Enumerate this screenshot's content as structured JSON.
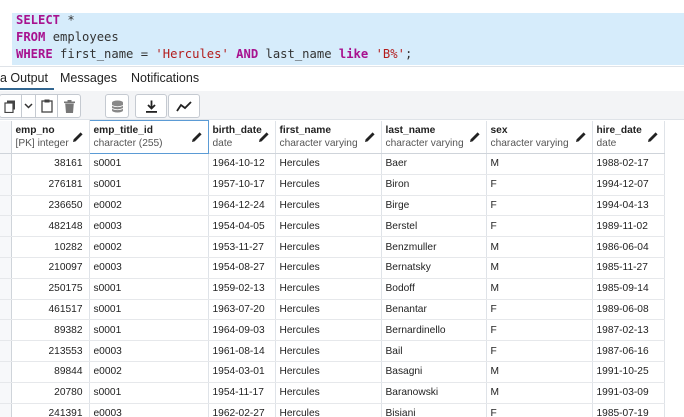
{
  "editor": {
    "line1": {
      "kw": "SELECT",
      "rest": " *"
    },
    "line2": {
      "kw": "FROM",
      "rest": " employees"
    },
    "line3": {
      "kw1": "WHERE",
      "p1": " first_name = ",
      "s1": "'Hercules'",
      "p2": " ",
      "kw2": "AND",
      "p3": " last_name ",
      "kw3": "like",
      "p4": " ",
      "s2": "'B%'",
      "p5": ";"
    }
  },
  "tabs": [
    {
      "label": "a Output",
      "active": true
    },
    {
      "label": "Messages",
      "active": false
    },
    {
      "label": "Notifications",
      "active": false
    }
  ],
  "toolbar": {
    "icons": [
      "copy-icon",
      "dropdown-arrow-icon",
      "paste-icon",
      "delete-icon",
      "save-data-icon",
      "download-icon",
      "graph-icon"
    ]
  },
  "columns": [
    {
      "name": "emp_no",
      "type": "[PK] integer"
    },
    {
      "name": "emp_title_id",
      "type": "character (255)"
    },
    {
      "name": "birth_date",
      "type": "date"
    },
    {
      "name": "first_name",
      "type": "character varying"
    },
    {
      "name": "last_name",
      "type": "character varying"
    },
    {
      "name": "sex",
      "type": "character varying"
    },
    {
      "name": "hire_date",
      "type": "date"
    }
  ],
  "rows": [
    [
      "38161",
      "s0001",
      "1964-10-12",
      "Hercules",
      "Baer",
      "M",
      "1988-02-17"
    ],
    [
      "276181",
      "s0001",
      "1957-10-17",
      "Hercules",
      "Biron",
      "F",
      "1994-12-07"
    ],
    [
      "236650",
      "e0002",
      "1964-12-24",
      "Hercules",
      "Birge",
      "F",
      "1994-04-13"
    ],
    [
      "482148",
      "e0003",
      "1954-04-05",
      "Hercules",
      "Berstel",
      "F",
      "1989-11-02"
    ],
    [
      "10282",
      "e0002",
      "1953-11-27",
      "Hercules",
      "Benzmuller",
      "M",
      "1986-06-04"
    ],
    [
      "210097",
      "e0003",
      "1954-08-27",
      "Hercules",
      "Bernatsky",
      "M",
      "1985-11-27"
    ],
    [
      "250175",
      "s0001",
      "1959-02-13",
      "Hercules",
      "Bodoff",
      "M",
      "1985-09-14"
    ],
    [
      "461517",
      "s0001",
      "1963-07-20",
      "Hercules",
      "Benantar",
      "F",
      "1989-06-08"
    ],
    [
      "89382",
      "s0001",
      "1964-09-03",
      "Hercules",
      "Bernardinello",
      "F",
      "1987-02-13"
    ],
    [
      "213553",
      "e0003",
      "1961-08-14",
      "Hercules",
      "Bail",
      "F",
      "1987-06-16"
    ],
    [
      "89844",
      "e0002",
      "1954-03-01",
      "Hercules",
      "Basagni",
      "M",
      "1991-10-25"
    ],
    [
      "20780",
      "s0001",
      "1954-11-17",
      "Hercules",
      "Baranowski",
      "M",
      "1991-03-09"
    ],
    [
      "241391",
      "e0003",
      "1962-02-27",
      "Hercules",
      "Bisiani",
      "F",
      "1985-07-19"
    ]
  ]
}
